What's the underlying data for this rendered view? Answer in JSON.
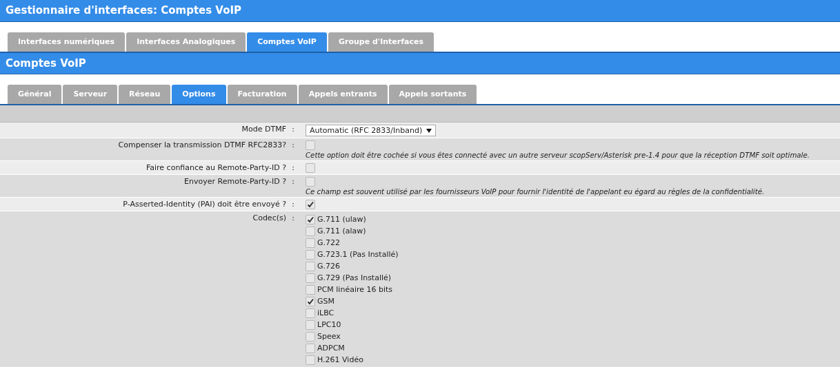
{
  "window": {
    "title": "Gestionnaire d'interfaces:  Comptes VoIP"
  },
  "tabs": [
    {
      "label": "Interfaces numériques",
      "selected": false
    },
    {
      "label": "Interfaces Analogiques",
      "selected": false
    },
    {
      "label": "Comptes VoIP",
      "selected": true
    },
    {
      "label": "Groupe d'Interfaces",
      "selected": false
    }
  ],
  "section": {
    "title": "Comptes VoIP"
  },
  "subtabs": [
    {
      "label": "Général",
      "selected": false
    },
    {
      "label": "Serveur",
      "selected": false
    },
    {
      "label": "Réseau",
      "selected": false
    },
    {
      "label": "Options",
      "selected": true
    },
    {
      "label": "Facturation",
      "selected": false
    },
    {
      "label": "Appels entrants",
      "selected": false
    },
    {
      "label": "Appels sortants",
      "selected": false
    }
  ],
  "rows": [
    {
      "kind": "select",
      "label": "Mode DTMF",
      "colon": ":",
      "value": "Automatic (RFC 2833/Inband)"
    },
    {
      "kind": "checkbox",
      "label": "Compenser la transmission DTMF RFC2833?",
      "colon": ":",
      "checked": false,
      "help": "Cette option doit être cochée si vous êtes connecté avec un autre serveur scopServ/Asterisk pre-1.4 pour que la réception DTMF soit optimale."
    },
    {
      "kind": "checkbox",
      "label": "Faire confiance au Remote-Party-ID ?",
      "colon": ":",
      "checked": false
    },
    {
      "kind": "checkbox",
      "label": "Envoyer Remote-Party-ID ?",
      "colon": ":",
      "checked": false,
      "help": "Ce champ est souvent utilisé par les fournisseurs VoIP pour fournir l'identité de l'appelant eu égard au règles de la confidentialité."
    },
    {
      "kind": "checkbox",
      "label": "P-Asserted-Identity (PAI) doit être envoyé ?",
      "colon": ":",
      "checked": true
    },
    {
      "kind": "checklist",
      "label": "Codec(s)",
      "colon": ":",
      "options": [
        {
          "label": "G.711 (ulaw)",
          "checked": true
        },
        {
          "label": "G.711 (alaw)",
          "checked": false
        },
        {
          "label": "G.722",
          "checked": false
        },
        {
          "label": "G.723.1 (Pas Installé)",
          "checked": false
        },
        {
          "label": "G.726",
          "checked": false
        },
        {
          "label": "G.729 (Pas Installé)",
          "checked": false
        },
        {
          "label": "PCM linéaire 16 bits",
          "checked": false
        },
        {
          "label": "GSM",
          "checked": true
        },
        {
          "label": "iLBC",
          "checked": false
        },
        {
          "label": "LPC10",
          "checked": false
        },
        {
          "label": "Speex",
          "checked": false
        },
        {
          "label": "ADPCM",
          "checked": false
        },
        {
          "label": "H.261 Vidéo",
          "checked": false
        }
      ]
    }
  ]
}
